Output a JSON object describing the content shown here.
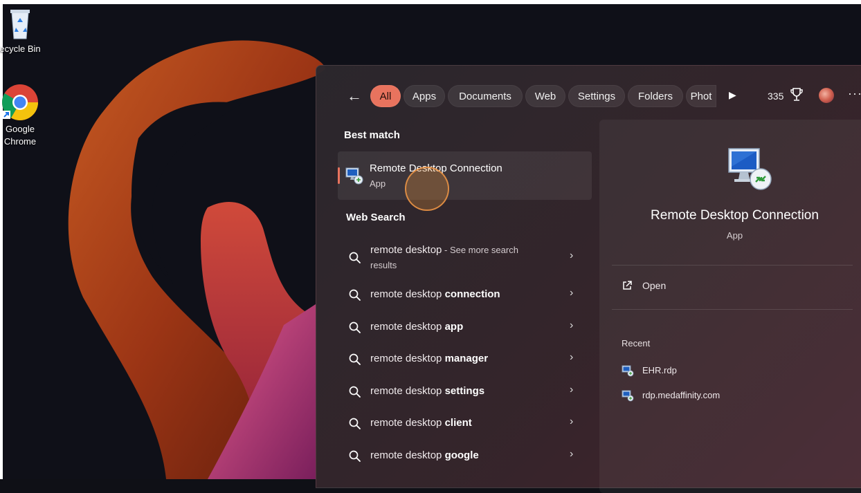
{
  "desktop": {
    "icons": [
      {
        "label": "ecycle Bin"
      },
      {
        "label_line1": "Google",
        "label_line2": "Chrome"
      }
    ]
  },
  "search": {
    "back_glyph": "←",
    "filters": [
      "All",
      "Apps",
      "Documents",
      "Web",
      "Settings",
      "Folders",
      "Phot"
    ],
    "active_filter": "All",
    "points": "335",
    "more_glyph": "···",
    "best_match": {
      "heading": "Best match",
      "title": "Remote Desktop Connection",
      "subtitle": "App"
    },
    "web_search": {
      "heading": "Web Search",
      "items": [
        {
          "prefix": "remote desktop",
          "bold": "",
          "suffix": " - See more search",
          "suffix2": "results"
        },
        {
          "prefix": "remote desktop ",
          "bold": "connection"
        },
        {
          "prefix": "remote desktop ",
          "bold": "app"
        },
        {
          "prefix": "remote desktop ",
          "bold": "manager"
        },
        {
          "prefix": "remote desktop ",
          "bold": "settings"
        },
        {
          "prefix": "remote desktop ",
          "bold": "client"
        },
        {
          "prefix": "remote desktop ",
          "bold": "google"
        }
      ]
    },
    "details": {
      "title": "Remote Desktop Connection",
      "subtitle": "App",
      "open_label": "Open",
      "recent_heading": "Recent",
      "recent": [
        "EHR.rdp",
        "rdp.medaffinity.com"
      ]
    }
  },
  "colors": {
    "accent": "#e8735e",
    "panel": "#2f2a30"
  }
}
